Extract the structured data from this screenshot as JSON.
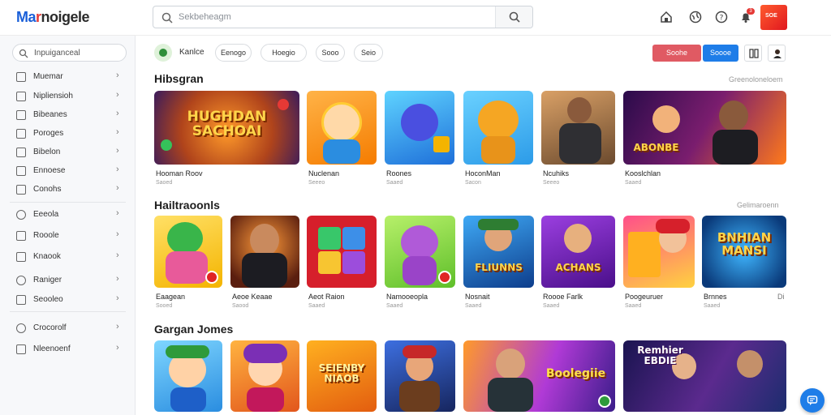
{
  "header": {
    "logo_part1": "Ma",
    "logo_part2": "r",
    "logo_part3": "noigele",
    "search_placeholder": "Sekbeheagm",
    "notification_count": "3",
    "avatar_text": "SOE"
  },
  "sidebar": {
    "search_text": "Inpuiganceal",
    "items": [
      {
        "label": "Muemar"
      },
      {
        "label": "Nipliensioh"
      },
      {
        "label": "Bibeanes"
      },
      {
        "label": "Poroges"
      },
      {
        "label": "Bibelon"
      },
      {
        "label": "Ennoese"
      },
      {
        "label": "Conohs"
      },
      {
        "label": "Eeeola"
      },
      {
        "label": "Rooole"
      },
      {
        "label": "Knaook"
      },
      {
        "label": "Raniger"
      },
      {
        "label": "Seooleo"
      },
      {
        "label": "Crocorolf"
      },
      {
        "label": "Nleenoenf"
      }
    ]
  },
  "filters": {
    "active_label": "Kanlce",
    "chips": [
      "Eenogo",
      "Hoegio",
      "Sooo",
      "Seio"
    ],
    "action_red": "Soohe",
    "action_blue": "Soooe"
  },
  "sections": [
    {
      "title": "Hibsgran",
      "see_all": "Greenoloneloem",
      "cards": [
        {
          "title": "Hooman Roov",
          "sub": "Saoed",
          "art": "HUGHDAN SACHOAI"
        },
        {
          "title": "Nuclenan",
          "sub": "Seeeo",
          "art": ""
        },
        {
          "title": "Roones",
          "sub": "Saaed",
          "art": ""
        },
        {
          "title": "HoconMan",
          "sub": "Sacon",
          "art": ""
        },
        {
          "title": "Ncuhiks",
          "sub": "Seeeo",
          "art": ""
        },
        {
          "title": "Kooslchlan",
          "sub": "Saaed",
          "art": "ABONBE"
        }
      ]
    },
    {
      "title": "Hailtraoonls",
      "see_all": "Gelimaroenn",
      "cards": [
        {
          "title": "Eaagean",
          "sub": "Sooed",
          "art": ""
        },
        {
          "title": "Aeoe Keaae",
          "sub": "Saood",
          "art": ""
        },
        {
          "title": "Aeot Raion",
          "sub": "Saaed",
          "art": ""
        },
        {
          "title": "Namooeopla",
          "sub": "Saaed",
          "art": ""
        },
        {
          "title": "Nosnait",
          "sub": "Saaed",
          "art": "FLIUNNS"
        },
        {
          "title": "Roooe Farlk",
          "sub": "Saaed",
          "art": "ACHANS"
        },
        {
          "title": "Poogeuruer",
          "sub": "Saaed",
          "art": ""
        },
        {
          "title": "Brnnes",
          "sub": "Saaed",
          "art": "BNHIAN MANSI"
        }
      ],
      "extra": "Di"
    },
    {
      "title": "Gargan Jomes",
      "cards": [
        {
          "art": ""
        },
        {
          "art": ""
        },
        {
          "art": "SEIENBY NIAOB"
        },
        {
          "art": ""
        },
        {
          "art": "Boolegiie"
        },
        {
          "art": "Remhier EBDIE"
        }
      ]
    }
  ],
  "colors": {
    "accent_blue": "#1e7de8",
    "accent_red": "#e05a63",
    "logo_blue": "#1a5fd8",
    "logo_red": "#e53935"
  }
}
